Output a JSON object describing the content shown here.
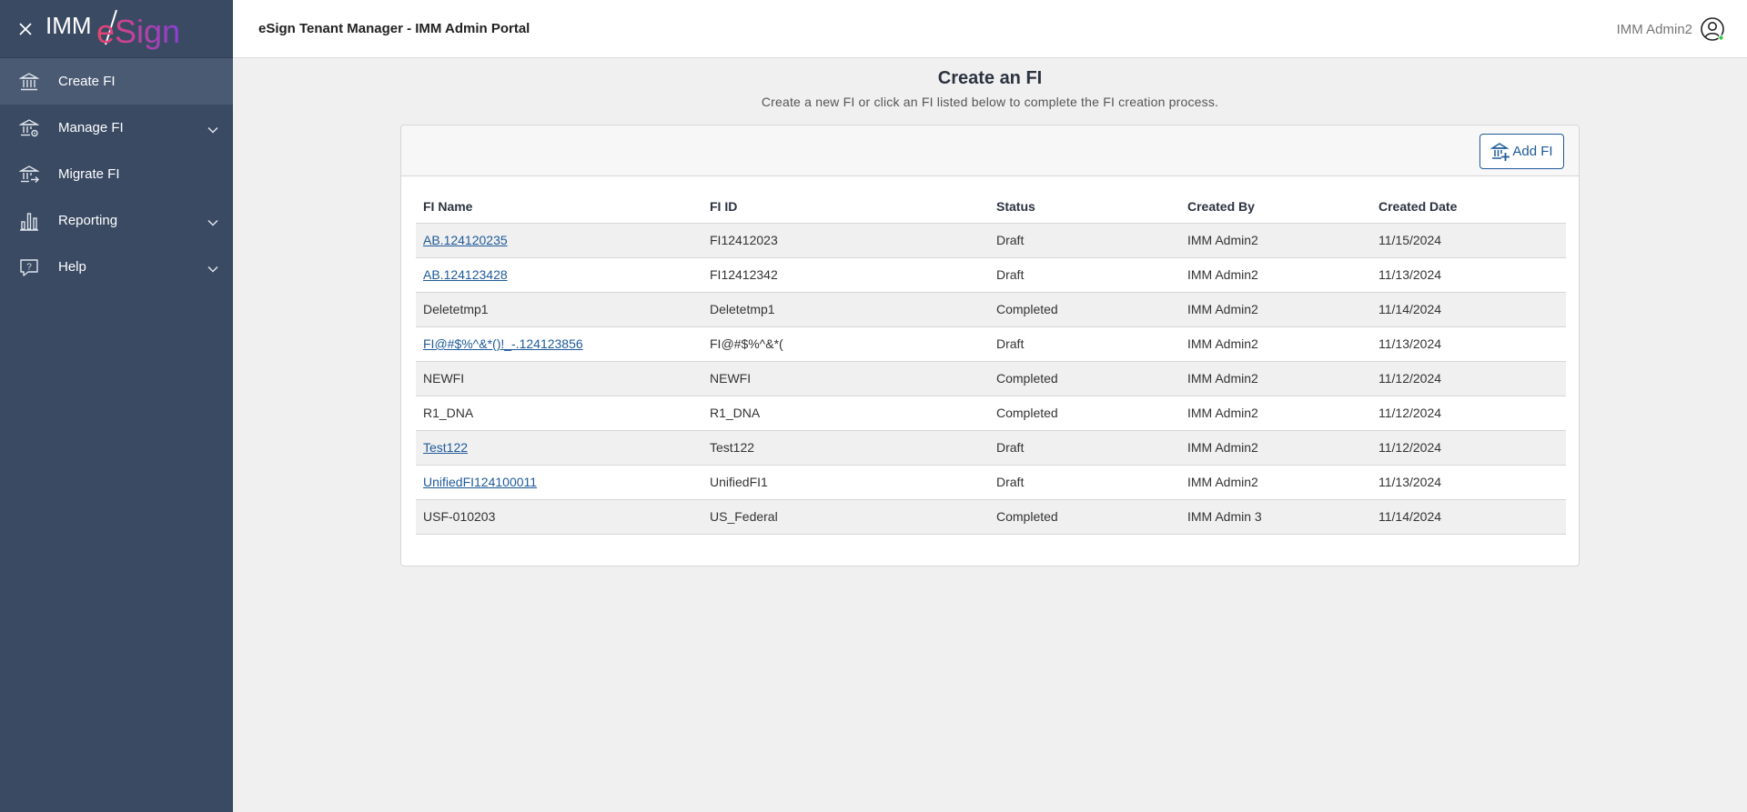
{
  "app": {
    "title": "eSign Tenant Manager - IMM Admin Portal",
    "logo_text_left": "IMM",
    "logo_text_right": "eSign"
  },
  "colors": {
    "sidebar": "#3a4a63",
    "sidebar_active": "#4a5a73",
    "link": "#1e5a99",
    "logo_gradient_start": "#e8466e",
    "logo_gradient_end": "#8a3fd6"
  },
  "sidebar": {
    "items": [
      {
        "label": "Create FI",
        "icon": "bank-icon",
        "active": true,
        "expandable": false
      },
      {
        "label": "Manage FI",
        "icon": "bank-settings-icon",
        "active": false,
        "expandable": true
      },
      {
        "label": "Migrate FI",
        "icon": "bank-migrate-icon",
        "active": false,
        "expandable": false
      },
      {
        "label": "Reporting",
        "icon": "bar-chart-icon",
        "active": false,
        "expandable": true
      },
      {
        "label": "Help",
        "icon": "help-icon",
        "active": false,
        "expandable": true
      }
    ]
  },
  "user": {
    "name": "IMM Admin2",
    "status_color": "#2ecc40"
  },
  "page": {
    "title": "Create an FI",
    "subtitle": "Create a new FI or click an FI listed below to complete the FI creation process."
  },
  "toolbar": {
    "add_label": "Add FI"
  },
  "table": {
    "columns": [
      "FI Name",
      "FI ID",
      "Status",
      "Created By",
      "Created Date"
    ],
    "rows": [
      {
        "name": "AB.124120235",
        "id": "FI12412023",
        "status": "Draft",
        "created_by": "IMM Admin2",
        "created_date": "11/15/2024",
        "link": true
      },
      {
        "name": "AB.124123428",
        "id": "FI12412342",
        "status": "Draft",
        "created_by": "IMM Admin2",
        "created_date": "11/13/2024",
        "link": true
      },
      {
        "name": "Deletetmp1",
        "id": "Deletetmp1",
        "status": "Completed",
        "created_by": "IMM Admin2",
        "created_date": "11/14/2024",
        "link": false
      },
      {
        "name": "FI@#$%^&*()!_-.124123856",
        "id": "FI@#$%^&*(",
        "status": "Draft",
        "created_by": "IMM Admin2",
        "created_date": "11/13/2024",
        "link": true
      },
      {
        "name": "NEWFI",
        "id": "NEWFI",
        "status": "Completed",
        "created_by": "IMM Admin2",
        "created_date": "11/12/2024",
        "link": false
      },
      {
        "name": "R1_DNA",
        "id": "R1_DNA",
        "status": "Completed",
        "created_by": "IMM Admin2",
        "created_date": "11/12/2024",
        "link": false
      },
      {
        "name": "Test122",
        "id": "Test122",
        "status": "Draft",
        "created_by": "IMM Admin2",
        "created_date": "11/12/2024",
        "link": true
      },
      {
        "name": "UnifiedFI124100011",
        "id": "UnifiedFI1",
        "status": "Draft",
        "created_by": "IMM Admin2",
        "created_date": "11/13/2024",
        "link": true
      },
      {
        "name": "USF-010203",
        "id": "US_Federal",
        "status": "Completed",
        "created_by": "IMM Admin 3",
        "created_date": "11/14/2024",
        "link": false
      }
    ]
  }
}
